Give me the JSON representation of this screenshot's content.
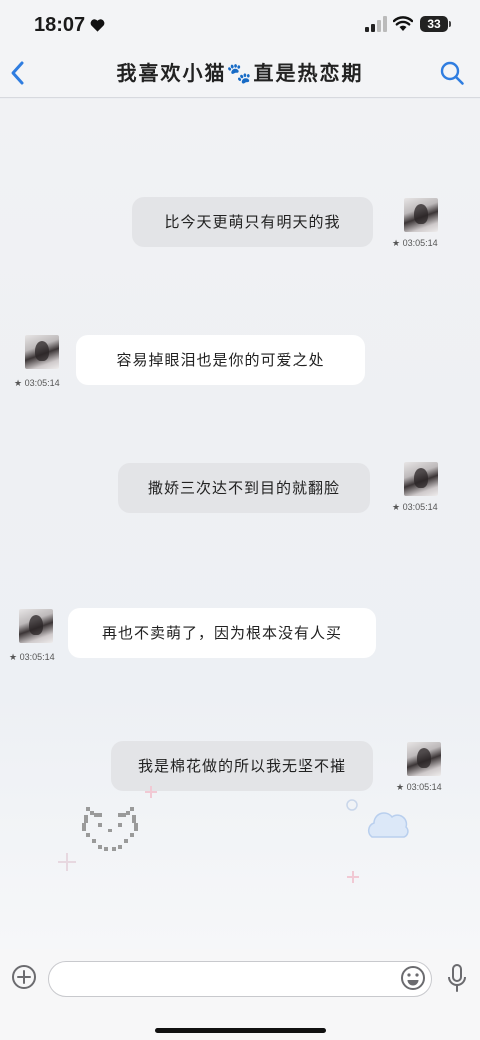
{
  "status_bar": {
    "time": "18:07",
    "battery": "33"
  },
  "header": {
    "title": "我喜欢小猫🐾直是热恋期"
  },
  "messages": [
    {
      "direction": "out",
      "text": "比今天更萌只有明天的我",
      "time": "★ 03:05:14"
    },
    {
      "direction": "in",
      "text": "容易掉眼泪也是你的可爱之处",
      "time": "★ 03:05:14"
    },
    {
      "direction": "out",
      "text": "撒娇三次达不到目的就翻脸",
      "time": "★ 03:05:14"
    },
    {
      "direction": "in",
      "text": "再也不卖萌了，因为根本没有人买",
      "time": "★ 03:05:14"
    },
    {
      "direction": "out",
      "text": "我是棉花做的所以我无坚不摧",
      "time": "★ 03:05:14"
    }
  ],
  "input": {
    "value": "",
    "placeholder": ""
  },
  "icons": {
    "back": "chevron-left-icon",
    "search": "search-icon",
    "add": "plus-circle-icon",
    "emoji": "smiley-icon",
    "mic": "microphone-icon"
  },
  "colors": {
    "accent": "#2f7de0",
    "bubble_out": "#e3e4e7",
    "bubble_in": "#ffffff"
  }
}
